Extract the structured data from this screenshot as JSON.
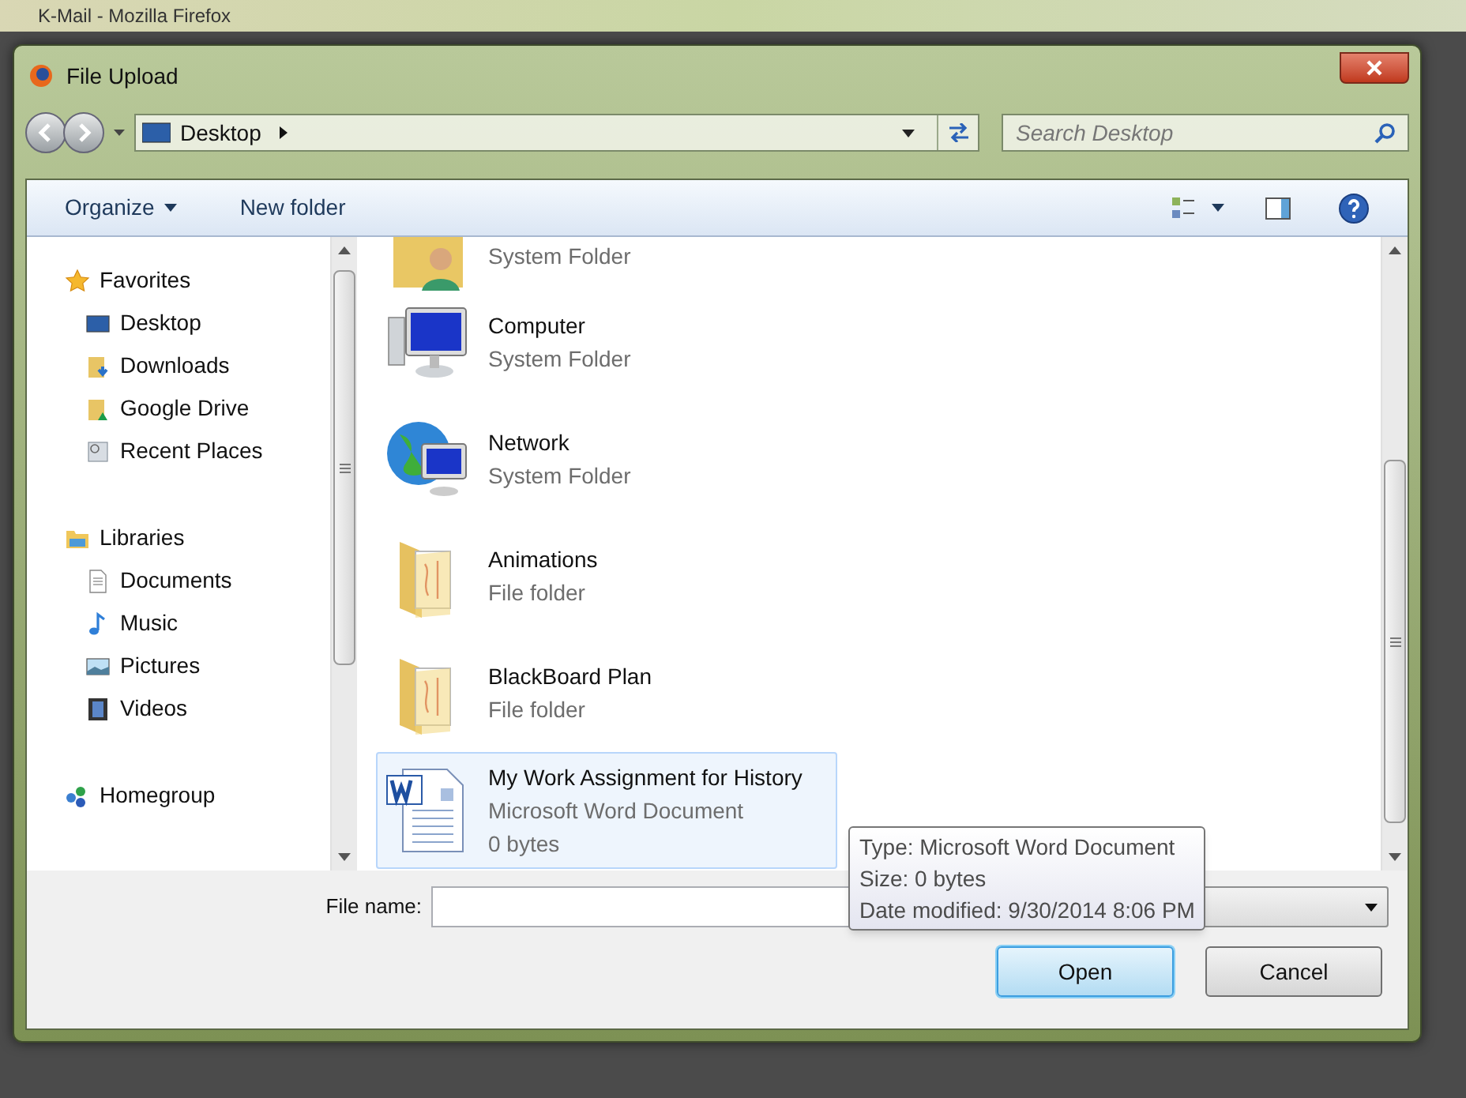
{
  "background_window": {
    "title": "K-Mail - Mozilla Firefox"
  },
  "window": {
    "title": "File Upload"
  },
  "address_bar": {
    "location": "Desktop"
  },
  "search": {
    "placeholder": "Search Desktop"
  },
  "toolbar": {
    "organize": "Organize",
    "new_folder": "New folder"
  },
  "sidebar": {
    "groups": [
      {
        "label": "Favorites",
        "kind": "favorites",
        "children": [
          {
            "label": "Desktop",
            "kind": "desktop"
          },
          {
            "label": "Downloads",
            "kind": "downloads"
          },
          {
            "label": "Google Drive",
            "kind": "drive"
          },
          {
            "label": "Recent Places",
            "kind": "recent"
          }
        ]
      },
      {
        "label": "Libraries",
        "kind": "libraries",
        "children": [
          {
            "label": "Documents",
            "kind": "documents"
          },
          {
            "label": "Music",
            "kind": "music"
          },
          {
            "label": "Pictures",
            "kind": "pictures"
          },
          {
            "label": "Videos",
            "kind": "videos"
          }
        ]
      },
      {
        "label": "Homegroup",
        "kind": "homegroup"
      }
    ]
  },
  "files": [
    {
      "kind": "user",
      "type": "System Folder",
      "selected": false
    },
    {
      "kind": "computer",
      "name": "Computer",
      "type": "System Folder",
      "selected": false
    },
    {
      "kind": "network",
      "name": "Network",
      "type": "System Folder",
      "selected": false
    },
    {
      "kind": "folder",
      "name": "Animations",
      "type": "File folder",
      "selected": false
    },
    {
      "kind": "folder",
      "name": "BlackBoard Plan",
      "type": "File folder",
      "selected": false
    },
    {
      "kind": "word",
      "name": "My Work Assignment for History",
      "type": "Microsoft Word Document",
      "size": "0 bytes",
      "selected": true
    }
  ],
  "tooltip": {
    "lines": [
      "Type: Microsoft Word Document",
      "Size: 0 bytes",
      "Date modified: 9/30/2014 8:06 PM"
    ]
  },
  "file_name": {
    "label": "File name:"
  },
  "buttons": [
    {
      "label": "Open",
      "default": true
    },
    {
      "label": "Cancel",
      "default": false
    }
  ]
}
